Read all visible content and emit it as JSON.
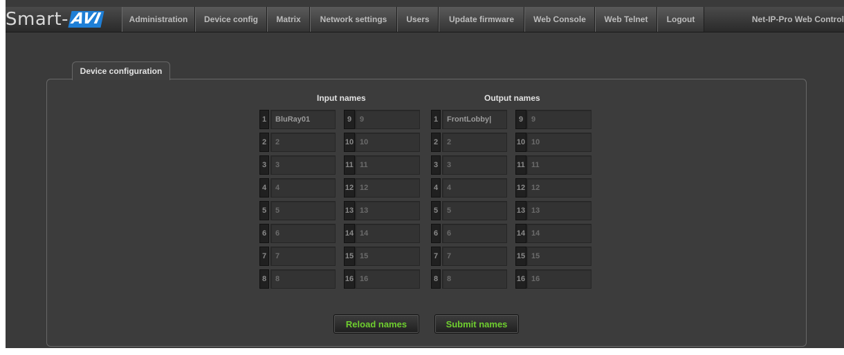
{
  "header": {
    "logo_text": "Smart-",
    "logo_badge": "AVI",
    "nav": [
      "Administration",
      "Device config",
      "Matrix",
      "Network settings",
      "Users",
      "Update firmware",
      "Web Console",
      "Web Telnet",
      "Logout"
    ],
    "product_title": "Net-IP-Pro Web Control"
  },
  "panel": {
    "tab_label": "Device configuration",
    "input_header": "Input names",
    "output_header": "Output names",
    "inputs": {
      "numbers": [
        "1",
        "2",
        "3",
        "4",
        "5",
        "6",
        "7",
        "8",
        "9",
        "10",
        "11",
        "12",
        "13",
        "14",
        "15",
        "16"
      ],
      "values": [
        "BluRay01",
        "2",
        "3",
        "4",
        "5",
        "6",
        "7",
        "8",
        "9",
        "10",
        "11",
        "12",
        "13",
        "14",
        "15",
        "16"
      ]
    },
    "outputs": {
      "numbers": [
        "1",
        "2",
        "3",
        "4",
        "5",
        "6",
        "7",
        "8",
        "9",
        "10",
        "11",
        "12",
        "13",
        "14",
        "15",
        "16"
      ],
      "values": [
        "FrontLobby|",
        "2",
        "3",
        "4",
        "5",
        "6",
        "7",
        "8",
        "9",
        "10",
        "11",
        "12",
        "13",
        "14",
        "15",
        "16"
      ]
    },
    "reload_label": "Reload names",
    "submit_label": "Submit names"
  },
  "colors": {
    "accent_green": "#6fcf2f",
    "logo_blue": "#1f7fd6"
  }
}
